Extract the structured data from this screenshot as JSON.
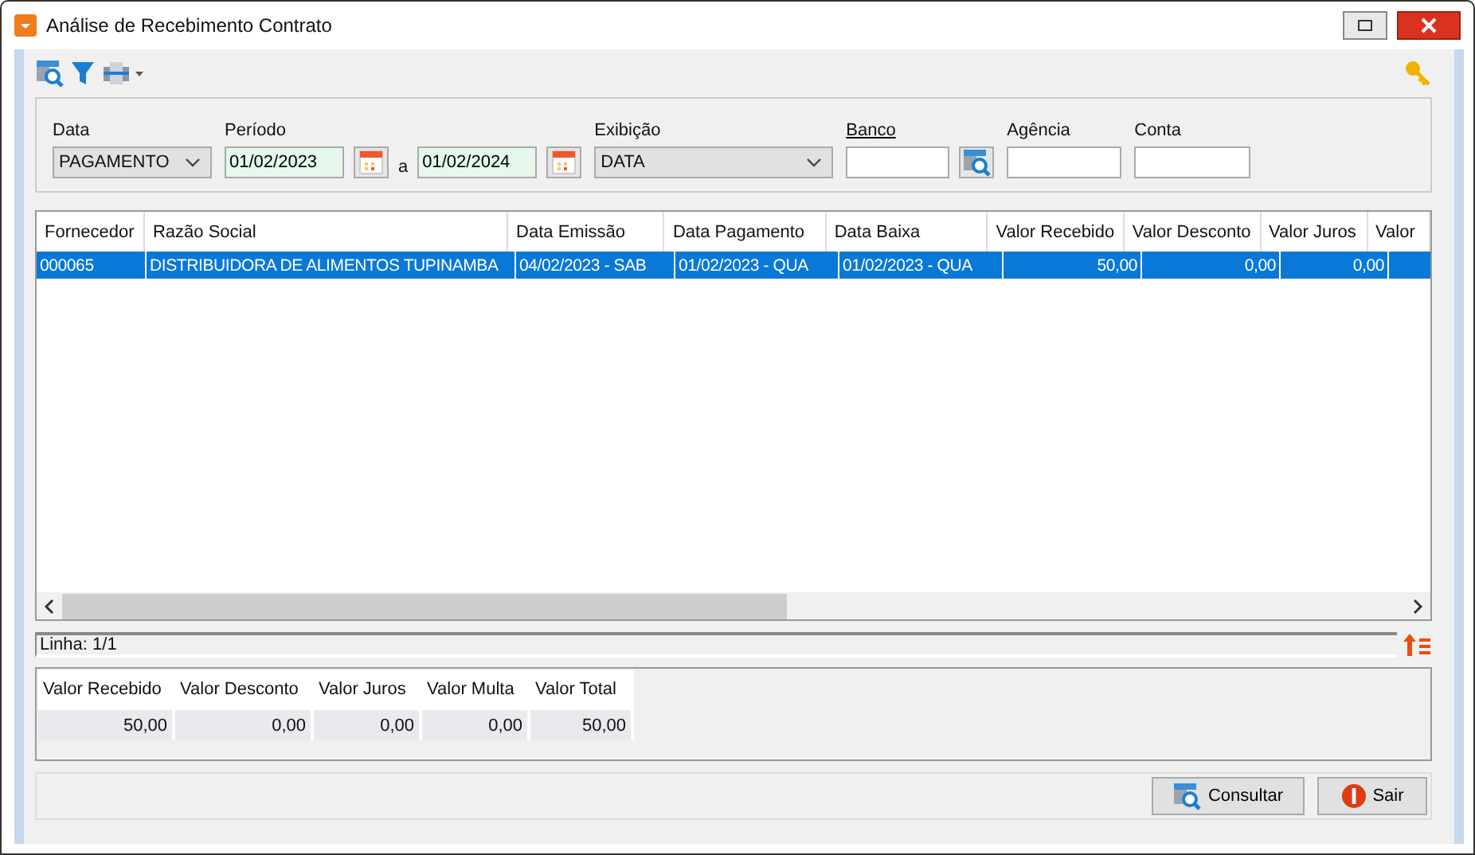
{
  "window": {
    "title": "Análise de Recebimento Contrato"
  },
  "filters": {
    "data": {
      "label": "Data",
      "value": "PAGAMENTO"
    },
    "periodo": {
      "label": "Período",
      "from": "01/02/2023",
      "separator": "a",
      "to": "01/02/2024"
    },
    "exibicao": {
      "label": "Exibição",
      "value": "DATA"
    },
    "banco": {
      "label": "Banco"
    },
    "agencia": {
      "label": "Agência"
    },
    "conta": {
      "label": "Conta"
    }
  },
  "table": {
    "columns": [
      {
        "label": "Fornecedor",
        "kind": "text"
      },
      {
        "label": "Razão Social",
        "kind": "text"
      },
      {
        "label": "Data Emissão",
        "kind": "text"
      },
      {
        "label": "Data Pagamento",
        "kind": "text"
      },
      {
        "label": "Data Baixa",
        "kind": "text"
      },
      {
        "label": "Valor Recebido",
        "kind": "number"
      },
      {
        "label": "Valor Desconto",
        "kind": "number"
      },
      {
        "label": "Valor Juros",
        "kind": "number"
      },
      {
        "label": "Valor"
      }
    ],
    "rows": [
      {
        "selected": true,
        "cells": [
          "000065",
          "DISTRIBUIDORA DE ALIMENTOS TUPINAMBA",
          "04/02/2023 - SAB",
          "01/02/2023 - QUA",
          "01/02/2023 - QUA",
          "50,00",
          "0,00",
          "0,00"
        ]
      }
    ]
  },
  "status_bar": {
    "text": "Linha: 1/1"
  },
  "totals": [
    {
      "label": "Valor Recebido",
      "value": "50,00"
    },
    {
      "label": "Valor Desconto",
      "value": "0,00"
    },
    {
      "label": "Valor Juros",
      "value": "0,00"
    },
    {
      "label": "Valor Multa",
      "value": "0,00"
    },
    {
      "label": "Valor Total",
      "value": "50,00"
    }
  ],
  "buttons": [
    {
      "kind": "search",
      "label": "Consultar"
    },
    {
      "kind": "exit",
      "label": "Sair"
    }
  ]
}
